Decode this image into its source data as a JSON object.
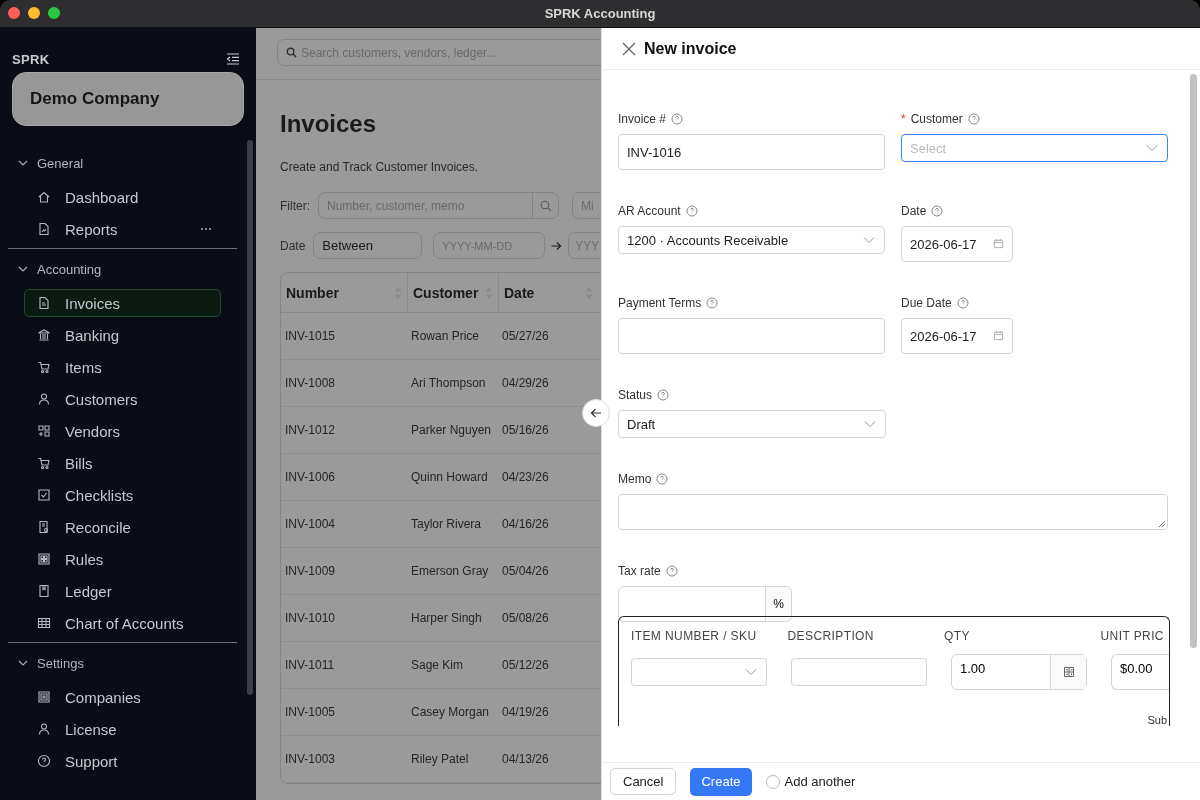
{
  "window": {
    "title": "SPRK Accounting"
  },
  "sidebar": {
    "brand": "SPRK",
    "company": "Demo Company",
    "sections": [
      {
        "title": "General",
        "expanded": true,
        "items": [
          {
            "label": "Dashboard",
            "selected": false,
            "has_menu": false
          },
          {
            "label": "Reports",
            "selected": false,
            "has_menu": true
          }
        ]
      },
      {
        "title": "Accounting",
        "expanded": true,
        "items": [
          {
            "label": "Invoices",
            "selected": true,
            "has_menu": false
          },
          {
            "label": "Banking",
            "selected": false,
            "has_menu": false
          },
          {
            "label": "Items",
            "selected": false,
            "has_menu": false
          },
          {
            "label": "Customers",
            "selected": false,
            "has_menu": false
          },
          {
            "label": "Vendors",
            "selected": false,
            "has_menu": false
          },
          {
            "label": "Bills",
            "selected": false,
            "has_menu": false
          },
          {
            "label": "Checklists",
            "selected": false,
            "has_menu": false
          },
          {
            "label": "Reconcile",
            "selected": false,
            "has_menu": false
          },
          {
            "label": "Rules",
            "selected": false,
            "has_menu": false
          },
          {
            "label": "Ledger",
            "selected": false,
            "has_menu": false
          },
          {
            "label": "Chart of Accounts",
            "selected": false,
            "has_menu": false
          }
        ]
      },
      {
        "title": "Settings",
        "expanded": true,
        "items": [
          {
            "label": "Companies",
            "selected": false,
            "has_menu": false
          },
          {
            "label": "License",
            "selected": false,
            "has_menu": false
          },
          {
            "label": "Support",
            "selected": false,
            "has_menu": false
          }
        ]
      }
    ]
  },
  "main": {
    "search": {
      "placeholder": "Search customers, vendors, ledger..."
    },
    "heading": "Invoices",
    "subtitle": "Create and Track Customer Invoices.",
    "filter": {
      "label": "Filter:",
      "placeholder": "Number, customer, memo",
      "min_placeholder": "Mi"
    },
    "date_filter": {
      "label": "Date",
      "mode": "Between",
      "from_placeholder": "YYYY-MM-DD",
      "to_placeholder": "YYY"
    },
    "table": {
      "columns": [
        "Number",
        "Customer",
        "Date"
      ],
      "rows": [
        [
          "INV-1015",
          "Rowan Price",
          "05/27/26"
        ],
        [
          "INV-1008",
          "Ari Thompson",
          "04/29/26"
        ],
        [
          "INV-1012",
          "Parker Nguyen",
          "05/16/26"
        ],
        [
          "INV-1006",
          "Quinn Howard",
          "04/23/26"
        ],
        [
          "INV-1004",
          "Taylor Rivera",
          "04/16/26"
        ],
        [
          "INV-1009",
          "Emerson Gray",
          "05/04/26"
        ],
        [
          "INV-1010",
          "Harper Singh",
          "05/08/26"
        ],
        [
          "INV-1011",
          "Sage Kim",
          "05/12/26"
        ],
        [
          "INV-1005",
          "Casey Morgan",
          "04/19/26"
        ],
        [
          "INV-1003",
          "Riley Patel",
          "04/13/26"
        ]
      ]
    }
  },
  "drawer": {
    "title": "New invoice",
    "rows": [
      [
        {
          "kind": "text",
          "label": "Invoice #",
          "focused": false,
          "value": "INV-1016"
        },
        {
          "kind": "select",
          "label": "Customer",
          "required_mark": "*",
          "focused": true,
          "placeholder": "Select"
        }
      ],
      [
        {
          "kind": "select",
          "label": "AR Account",
          "focused": false,
          "value": "1200 · Accounts Receivable"
        },
        {
          "kind": "date",
          "label": "Date",
          "focused": false,
          "value": "2026-06-17"
        }
      ],
      [
        {
          "kind": "text",
          "label": "Payment Terms",
          "focused": false
        },
        {
          "kind": "date",
          "label": "Due Date",
          "focused": false,
          "value": "2026-06-17"
        }
      ],
      [
        {
          "kind": "select",
          "label": "Status",
          "focused": false,
          "value": "Draft"
        }
      ],
      [
        {
          "kind": "textarea",
          "label": "Memo",
          "focused": false
        }
      ],
      [
        {
          "kind": "percent",
          "label": "Tax rate",
          "focused": false,
          "suffix": "%"
        }
      ]
    ],
    "line_items": {
      "columns": [
        "ITEM NUMBER / SKU",
        "DESCRIPTION",
        "QTY",
        "UNIT PRIC"
      ],
      "qty": "1.00",
      "unit_price": "$0.00",
      "subtotal_label": "Sub"
    },
    "footer": {
      "cancel": "Cancel",
      "create": "Create",
      "add_another": {
        "label": "Add another",
        "checked": false
      }
    }
  }
}
